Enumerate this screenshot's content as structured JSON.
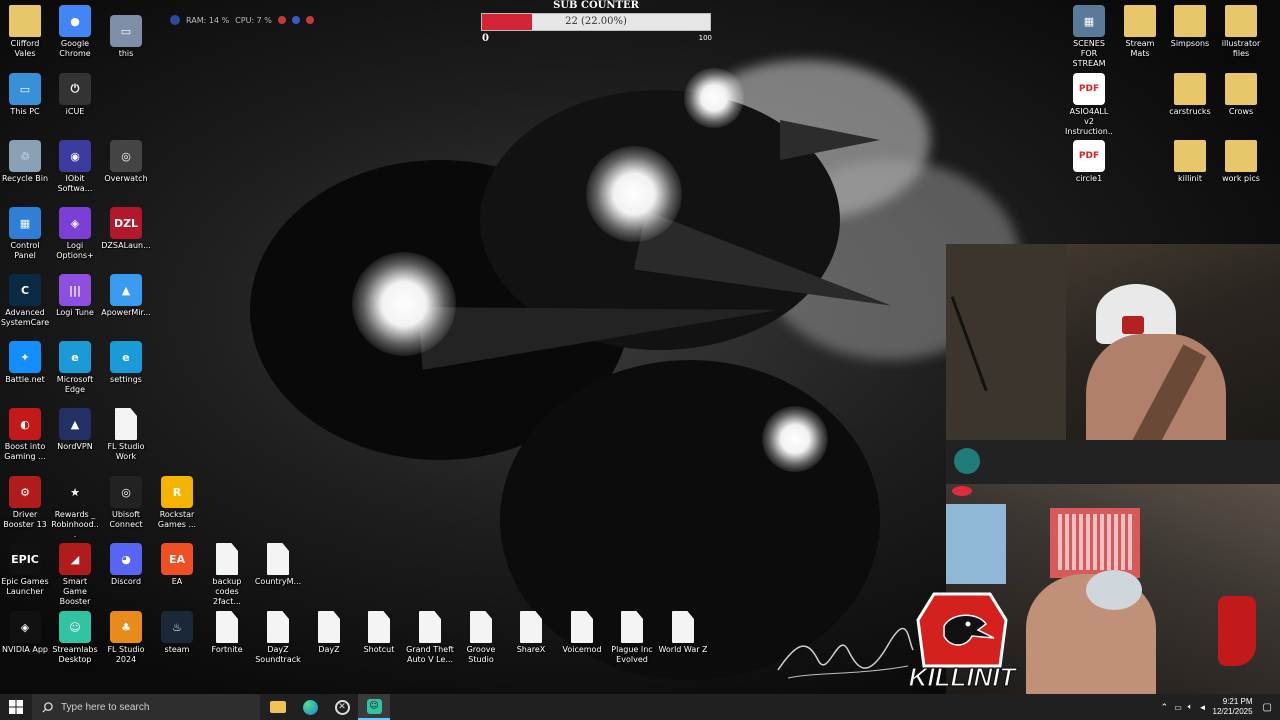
{
  "desktop_icons_left": [
    {
      "id": "clifford",
      "label": "Clifford Vales",
      "kind": "folder",
      "color": "#e8c76a",
      "glyph": ""
    },
    {
      "id": "chrome",
      "label": "Google Chrome",
      "kind": "app",
      "color": "#4285f4",
      "glyph": "●"
    },
    {
      "id": "this",
      "label": "this",
      "kind": "app",
      "color": "#7d8ea6",
      "glyph": "▭"
    },
    {
      "id": "thispc",
      "label": "This PC",
      "kind": "app",
      "color": "#3a8fd9",
      "glyph": "▭"
    },
    {
      "id": "icue",
      "label": "iCUE",
      "kind": "app",
      "color": "#333",
      "glyph": "⏻"
    },
    {
      "id": "recycle",
      "label": "Recycle Bin",
      "kind": "app",
      "color": "#8aa0b5",
      "glyph": "♲"
    },
    {
      "id": "iobit",
      "label": "IObit Softwa...",
      "kind": "app",
      "color": "#3b3b9e",
      "glyph": "◉"
    },
    {
      "id": "overwatch",
      "label": "Overwatch",
      "kind": "app",
      "color": "#444",
      "glyph": "◎"
    },
    {
      "id": "controlpanel",
      "label": "Control Panel",
      "kind": "app",
      "color": "#2f7fd6",
      "glyph": "▦"
    },
    {
      "id": "logioptions",
      "label": "Logi Options+",
      "kind": "app",
      "color": "#7b3fd6",
      "glyph": "◈"
    },
    {
      "id": "dzsa",
      "label": "DZSALaun...",
      "kind": "app",
      "color": "#b2182b",
      "glyph": "DZL"
    },
    {
      "id": "asc",
      "label": "Advanced SystemCare",
      "kind": "app",
      "color": "#0a2a44",
      "glyph": "C"
    },
    {
      "id": "logitune",
      "label": "Logi Tune",
      "kind": "app",
      "color": "#8d4fe0",
      "glyph": "|||"
    },
    {
      "id": "apowermirror",
      "label": "ApowerMir...",
      "kind": "app",
      "color": "#3a9bf0",
      "glyph": "▲"
    },
    {
      "id": "battlenet",
      "label": "Battle.net",
      "kind": "app",
      "color": "#148eff",
      "glyph": "✦"
    },
    {
      "id": "edge",
      "label": "Microsoft Edge",
      "kind": "app",
      "color": "#1a9bd7",
      "glyph": "e"
    },
    {
      "id": "settings",
      "label": "settings",
      "kind": "app",
      "color": "#1a9bd7",
      "glyph": "e"
    },
    {
      "id": "boostgaming",
      "label": "Boost into Gaming ...",
      "kind": "app",
      "color": "#c21a1a",
      "glyph": "◐"
    },
    {
      "id": "nordvpn",
      "label": "NordVPN",
      "kind": "app",
      "color": "#223063",
      "glyph": "▲"
    },
    {
      "id": "flstudiowork",
      "label": "FL Studio Work",
      "kind": "doc",
      "color": "#f4f4f4",
      "glyph": ""
    },
    {
      "id": "driverbooster",
      "label": "Driver Booster 13",
      "kind": "app",
      "color": "#b01b1b",
      "glyph": "⚙"
    },
    {
      "id": "rewards",
      "label": "Rewards _ Robinhood...",
      "kind": "app",
      "color": "transparent",
      "glyph": "★"
    },
    {
      "id": "ubisoft",
      "label": "Ubisoft Connect",
      "kind": "app",
      "color": "#222",
      "glyph": "◎"
    },
    {
      "id": "rockstar",
      "label": "Rockstar Games ...",
      "kind": "app",
      "color": "#f5b400",
      "glyph": "R"
    },
    {
      "id": "epic",
      "label": "Epic Games Launcher",
      "kind": "app",
      "color": "#111",
      "glyph": "EPIC"
    },
    {
      "id": "smartgame",
      "label": "Smart Game Booster",
      "kind": "app",
      "color": "#b01b1b",
      "glyph": "◢"
    },
    {
      "id": "discord",
      "label": "Discord",
      "kind": "app",
      "color": "#5865f2",
      "glyph": "◕"
    },
    {
      "id": "ea",
      "label": "EA",
      "kind": "app",
      "color": "#f04e23",
      "glyph": "EA"
    },
    {
      "id": "backupcodes",
      "label": "backup codes 2fact...",
      "kind": "doc",
      "color": "#f4f4f4",
      "glyph": ""
    },
    {
      "id": "countrym",
      "label": "CountryM...",
      "kind": "doc",
      "color": "#f4f4f4",
      "glyph": ""
    },
    {
      "id": "nvidia",
      "label": "NVIDIA App",
      "kind": "app",
      "color": "#111",
      "glyph": "◈"
    },
    {
      "id": "streamlabs",
      "label": "Streamlabs Desktop",
      "kind": "app",
      "color": "#31c3a2",
      "glyph": "☺"
    },
    {
      "id": "flstudio2024",
      "label": "FL Studio 2024",
      "kind": "app",
      "color": "#e88b1a",
      "glyph": "♣"
    },
    {
      "id": "steam",
      "label": "steam",
      "kind": "app",
      "color": "#1b2838",
      "glyph": "♨"
    },
    {
      "id": "fortnite",
      "label": "Fortnite",
      "kind": "doc",
      "color": "#f4f4f4",
      "glyph": ""
    },
    {
      "id": "dayzsoundtrack",
      "label": "DayZ Soundtrack",
      "kind": "doc",
      "color": "#f4f4f4",
      "glyph": ""
    },
    {
      "id": "dayz",
      "label": "DayZ",
      "kind": "doc",
      "color": "#f4f4f4",
      "glyph": ""
    },
    {
      "id": "shotcut",
      "label": "Shotcut",
      "kind": "doc",
      "color": "#f4f4f4",
      "glyph": ""
    },
    {
      "id": "gta",
      "label": "Grand Theft Auto V Le...",
      "kind": "doc",
      "color": "#f4f4f4",
      "glyph": ""
    },
    {
      "id": "groove",
      "label": "Groove Studio",
      "kind": "doc",
      "color": "#f4f4f4",
      "glyph": ""
    },
    {
      "id": "sharex",
      "label": "ShareX",
      "kind": "doc",
      "color": "#f4f4f4",
      "glyph": ""
    },
    {
      "id": "voicemod",
      "label": "Voicemod",
      "kind": "doc",
      "color": "#f4f4f4",
      "glyph": ""
    },
    {
      "id": "plague",
      "label": "Plague Inc Evolved",
      "kind": "doc",
      "color": "#f4f4f4",
      "glyph": ""
    },
    {
      "id": "worldwarz",
      "label": "World War Z",
      "kind": "doc",
      "color": "#f4f4f4",
      "glyph": ""
    }
  ],
  "desktop_icons_right": [
    {
      "id": "scenes",
      "label": "SCENES FOR STREAM",
      "kind": "app",
      "color": "#5a7a9a",
      "glyph": "▦"
    },
    {
      "id": "streammats",
      "label": "Stream Mats",
      "kind": "folder",
      "color": "#e8c76a",
      "glyph": ""
    },
    {
      "id": "simpsons",
      "label": "Simpsons",
      "kind": "folder",
      "color": "#e8c76a",
      "glyph": ""
    },
    {
      "id": "illustrator",
      "label": "illustrator files",
      "kind": "folder",
      "color": "#e8c76a",
      "glyph": ""
    },
    {
      "id": "asio",
      "label": "ASIO4ALL v2 Instruction...",
      "kind": "pdf",
      "color": "#fff",
      "glyph": "PDF"
    },
    {
      "id": "carstrucks",
      "label": "carstrucks",
      "kind": "folder",
      "color": "#e8c76a",
      "glyph": ""
    },
    {
      "id": "crows",
      "label": "Crows",
      "kind": "folder",
      "color": "#e8c76a",
      "glyph": ""
    },
    {
      "id": "circle1",
      "label": "circle1",
      "kind": "pdf",
      "color": "#fff",
      "glyph": "PDF"
    },
    {
      "id": "killinit",
      "label": "killinit",
      "kind": "folder",
      "color": "#e8c76a",
      "glyph": ""
    },
    {
      "id": "workpics",
      "label": "work pics",
      "kind": "folder",
      "color": "#e8c76a",
      "glyph": ""
    }
  ],
  "sub_counter": {
    "title": "SUB COUNTER",
    "text": "22 (22.00%)",
    "min": "0",
    "max": "100",
    "fraction": 0.22
  },
  "perf_overlay": {
    "ram": "RAM: 14 %",
    "cpu": "CPU: 7 %"
  },
  "logo_text": "KILLINIT",
  "taskbar": {
    "search_placeholder": "Type here to search",
    "time": "9:21 PM",
    "date": "12/21/2025"
  },
  "colors": {
    "taskbar_bg": "#202020",
    "sub_fill": "#d42536",
    "logo_red": "#d4211e"
  }
}
